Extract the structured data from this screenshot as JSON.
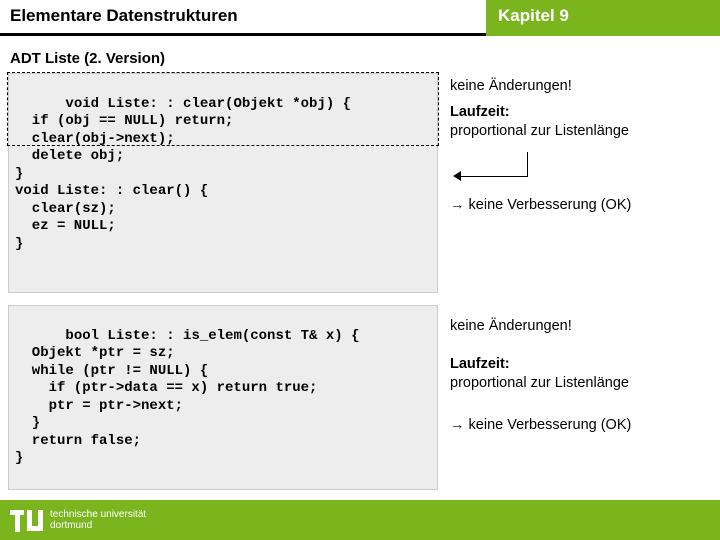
{
  "header": {
    "title": "Elementare Datenstrukturen",
    "chapter": "Kapitel 9"
  },
  "subtitle": "ADT Liste (2. Version)",
  "block1": {
    "code": "void Liste: : clear(Objekt *obj) {\n  if (obj == NULL) return;\n  clear(obj->next);\n  delete obj;\n}\nvoid Liste: : clear() {\n  clear(sz);\n  ez = NULL;\n}",
    "note_nochange": "keine Änderungen!",
    "runtime_label": "Laufzeit:",
    "runtime_text": "proportional zur Listenlänge",
    "conclusion": "→ keine Verbesserung (OK)"
  },
  "block2": {
    "code": "bool Liste: : is_elem(const T& x) {\n  Objekt *ptr = sz;\n  while (ptr != NULL) {\n    if (ptr->data == x) return true;\n    ptr = ptr->next;\n  }\n  return false;\n}",
    "note_nochange": "keine Änderungen!",
    "runtime_label": "Laufzeit:",
    "runtime_text": "proportional zur Listenlänge",
    "conclusion": "→ keine Verbesserung (OK)"
  },
  "footer": {
    "uni_line1": "technische universität",
    "uni_line2": "dortmund"
  }
}
